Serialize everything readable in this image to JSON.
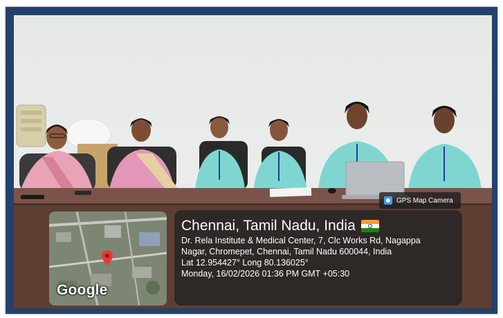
{
  "scene_description_icons": [
    "gps-map-camera-icon",
    "location-pin-icon",
    "india-flag-icon"
  ],
  "camera_tag": {
    "label": "GPS Map Camera"
  },
  "map": {
    "brand": "Google"
  },
  "location": {
    "city": "Chennai, Tamil Nadu, India",
    "address_line1": "Dr. Rela Institute & Medical Center, 7, Clc Works Rd, Nagappa",
    "address_line2": "Nagar, Chromepet, Chennai, Tamil Nadu 600044, India",
    "coordinates": "Lat 12.954427° Long 80.136025°",
    "timestamp": "Monday, 16/02/2026 01:36 PM GMT +05:30"
  },
  "colors": {
    "frame": "#23416a",
    "wall": "#e8eaea",
    "table": "#5e3e33",
    "uniform": "#7fd6d0",
    "flag_saffron": "#ff9933",
    "flag_green": "#138808"
  }
}
